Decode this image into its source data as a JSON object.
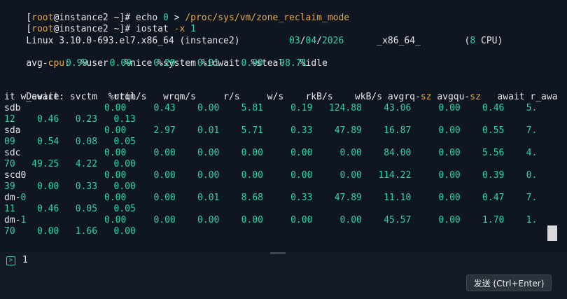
{
  "terminal": {
    "line1": {
      "b1": "[",
      "user": "root",
      "at": "@",
      "host": "instance2",
      "dir": " ~",
      "b2": "]",
      "sym": "# ",
      "cmd": "echo ",
      "zero": "0",
      "redir": " > ",
      "path": "/proc/sys/vm/zone_reclaim_mode"
    },
    "line2": {
      "b1": "[",
      "user": "root",
      "at": "@",
      "host": "instance2",
      "dir": " ~",
      "b2": "]",
      "sym": "# ",
      "cmd": "iostat ",
      "flag": "-x",
      "space": " ",
      "arg": "1"
    },
    "line3": {
      "os": "Linux ",
      "kernel": "3.10.0-693.el7.x86_64 (instance2)",
      "sp": "         ",
      "m": "03",
      "s1": "/",
      "d": "04",
      "s2": "/",
      "y": "2026",
      "sp2": "      ",
      "arch": "_x86_64_",
      "sp3": "        ",
      "cpus_open": "(",
      "cpus_n": "8",
      "cpus_close": " CPU)"
    },
    "cpu": {
      "label_a": "avg-",
      "label_b": "cpu",
      "label_c": ":  ",
      "headers": "%user   %nice %system %iowait  %steal   %idle",
      "values": "0.99    0.00    0.29    0.01    0.00   98.71"
    },
    "device_header_1": "Device:         rrqm/s   wrqm/s     r/s     w/s    rkB/s    wkB/s avgrq-",
    "device_header_sz1": "sz",
    "device_header_2": " avgqu-",
    "device_header_sz2": "sz",
    "device_header_3": "   await r_awa",
    "device_header_wrap": "it w_await  svctm  %util",
    "devices": [
      {
        "name": "sdb",
        "row1": "0.00     0.43    0.00    5.81     0.19   124.88    43.06     0.00    0.46    5.",
        "row2": "12    0.46   0.23   0.13"
      },
      {
        "name": "sda",
        "row1": "0.00     2.97    0.01    5.71     0.33    47.89    16.87     0.00    0.55    7.",
        "row2": "09    0.54   0.08   0.05"
      },
      {
        "name": "sdc",
        "row1": "0.00     0.00    0.00    0.00     0.00     0.00    84.00     0.00    5.56    4.",
        "row2": "70   49.25   4.22   0.00"
      },
      {
        "name": "scd0",
        "row1": "0.00     0.00    0.00    0.00     0.00     0.00   114.22     0.00    0.39    0.",
        "row2": "39    0.00   0.33   0.00"
      },
      {
        "name_a": "dm-",
        "name_b": "0",
        "row1": "0.00     0.00    0.01    8.68     0.33    47.89    11.10     0.00    0.47    7.",
        "row2": "11    0.46   0.05   0.05"
      },
      {
        "name_a": "dm-",
        "name_b": "1",
        "row1": "0.00     0.00    0.00    0.00     0.00     0.00    45.57     0.00    1.70    1.",
        "row2": "70    0.00   1.66   0.00"
      }
    ]
  },
  "input": {
    "icon": "prompt-icon",
    "value": "1"
  },
  "send_button": {
    "label": "发送 (Ctrl+Enter)"
  },
  "colors": {
    "accent": "#2dd4a6",
    "orange": "#e5a94a",
    "background": "#0f1622"
  }
}
